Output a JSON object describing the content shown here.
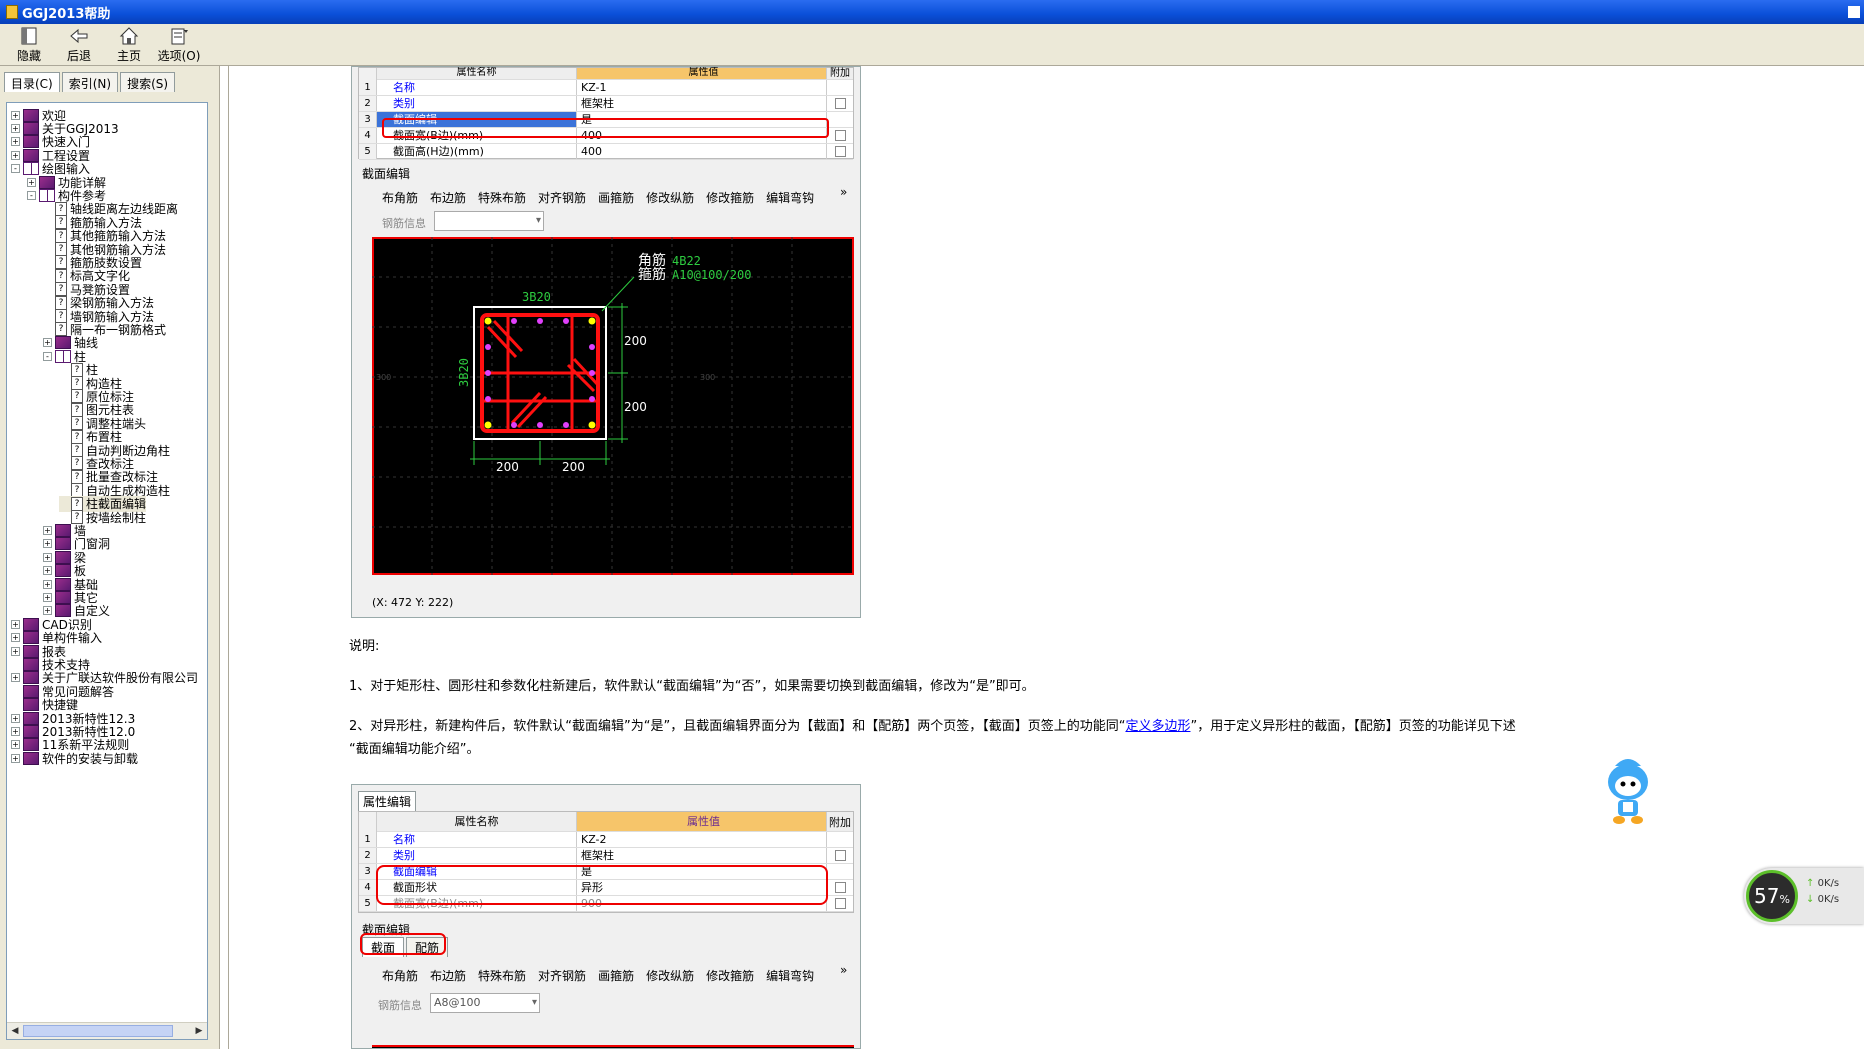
{
  "window": {
    "title": "GGJ2013帮助"
  },
  "toolbar": {
    "hide": "隐藏",
    "back": "后退",
    "home": "主页",
    "options": "选项(O)"
  },
  "tabs": {
    "contents": "目录(C)",
    "index": "索引(N)",
    "search": "搜索(S)"
  },
  "tree": [
    {
      "label": "欢迎",
      "level": 0,
      "kind": "book",
      "expander": "+"
    },
    {
      "label": "关于GGJ2013",
      "level": 0,
      "kind": "book",
      "expander": "+"
    },
    {
      "label": "快速入门",
      "level": 0,
      "kind": "book",
      "expander": "+"
    },
    {
      "label": "工程设置",
      "level": 0,
      "kind": "book",
      "expander": "+"
    },
    {
      "label": "绘图输入",
      "level": 0,
      "kind": "obook",
      "expander": "-"
    },
    {
      "label": "功能详解",
      "level": 1,
      "kind": "book",
      "expander": "+"
    },
    {
      "label": "构件参考",
      "level": 1,
      "kind": "obook",
      "expander": "-"
    },
    {
      "label": "轴线距离左边线距离",
      "level": 2,
      "kind": "page"
    },
    {
      "label": "箍筋输入方法",
      "level": 2,
      "kind": "page"
    },
    {
      "label": "其他箍筋输入方法",
      "level": 2,
      "kind": "page"
    },
    {
      "label": "其他钢筋输入方法",
      "level": 2,
      "kind": "page"
    },
    {
      "label": "箍筋肢数设置",
      "level": 2,
      "kind": "page"
    },
    {
      "label": "标高文字化",
      "level": 2,
      "kind": "page"
    },
    {
      "label": "马凳筋设置",
      "level": 2,
      "kind": "page"
    },
    {
      "label": "梁钢筋输入方法",
      "level": 2,
      "kind": "page"
    },
    {
      "label": "墙钢筋输入方法",
      "level": 2,
      "kind": "page"
    },
    {
      "label": "隔一布一钢筋格式",
      "level": 2,
      "kind": "page"
    },
    {
      "label": "轴线",
      "level": 2,
      "kind": "book",
      "expander": "+"
    },
    {
      "label": "柱",
      "level": 2,
      "kind": "obook",
      "expander": "-"
    },
    {
      "label": "柱",
      "level": 3,
      "kind": "page"
    },
    {
      "label": "构造柱",
      "level": 3,
      "kind": "page"
    },
    {
      "label": "原位标注",
      "level": 3,
      "kind": "page"
    },
    {
      "label": "图元柱表",
      "level": 3,
      "kind": "page"
    },
    {
      "label": "调整柱端头",
      "level": 3,
      "kind": "page"
    },
    {
      "label": "布置柱",
      "level": 3,
      "kind": "page"
    },
    {
      "label": "自动判断边角柱",
      "level": 3,
      "kind": "page"
    },
    {
      "label": "查改标注",
      "level": 3,
      "kind": "page"
    },
    {
      "label": "批量查改标注",
      "level": 3,
      "kind": "page"
    },
    {
      "label": "自动生成构造柱",
      "level": 3,
      "kind": "page"
    },
    {
      "label": "柱截面编辑",
      "level": 3,
      "kind": "page",
      "selected": true
    },
    {
      "label": "按墙绘制柱",
      "level": 3,
      "kind": "page"
    },
    {
      "label": "墙",
      "level": 2,
      "kind": "book",
      "expander": "+"
    },
    {
      "label": "门窗洞",
      "level": 2,
      "kind": "book",
      "expander": "+"
    },
    {
      "label": "梁",
      "level": 2,
      "kind": "book",
      "expander": "+"
    },
    {
      "label": "板",
      "level": 2,
      "kind": "book",
      "expander": "+"
    },
    {
      "label": "基础",
      "level": 2,
      "kind": "book",
      "expander": "+"
    },
    {
      "label": "其它",
      "level": 2,
      "kind": "book",
      "expander": "+"
    },
    {
      "label": "自定义",
      "level": 2,
      "kind": "book",
      "expander": "+"
    },
    {
      "label": "CAD识别",
      "level": 0,
      "kind": "book",
      "expander": "+"
    },
    {
      "label": "单构件输入",
      "level": 0,
      "kind": "book",
      "expander": "+"
    },
    {
      "label": "报表",
      "level": 0,
      "kind": "book",
      "expander": "+"
    },
    {
      "label": "技术支持",
      "level": 0,
      "kind": "book"
    },
    {
      "label": "关于广联达软件股份有限公司",
      "level": 0,
      "kind": "book",
      "expander": "+"
    },
    {
      "label": "常见问题解答",
      "level": 0,
      "kind": "book"
    },
    {
      "label": "快捷键",
      "level": 0,
      "kind": "book"
    },
    {
      "label": "2013新特性12.3",
      "level": 0,
      "kind": "book",
      "expander": "+"
    },
    {
      "label": "2013新特性12.0",
      "level": 0,
      "kind": "book",
      "expander": "+"
    },
    {
      "label": "11系新平法规则",
      "level": 0,
      "kind": "book",
      "expander": "+"
    },
    {
      "label": "软件的安装与卸载",
      "level": 0,
      "kind": "book",
      "expander": "+"
    }
  ],
  "shot1": {
    "header": {
      "name": "属性名称",
      "value": "属性值",
      "extra": "附加"
    },
    "rows": [
      {
        "n": "1",
        "name": "名称",
        "value": "KZ-1",
        "check": false
      },
      {
        "n": "2",
        "name": "类别",
        "value": "框架柱",
        "check": true
      },
      {
        "n": "3",
        "name": "截面编辑",
        "value": "是",
        "check": false
      },
      {
        "n": "4",
        "name": "截面宽(B边)(mm)",
        "value": "400",
        "check": true
      },
      {
        "n": "5",
        "name": "截面高(H边)(mm)",
        "value": "400",
        "check": true
      }
    ],
    "panel_title": "截面编辑",
    "tools": [
      "布角筋",
      "布边筋",
      "特殊布筋",
      "对齐钢筋",
      "画箍筋",
      "修改纵筋",
      "修改箍筋",
      "编辑弯钩"
    ],
    "more": "»",
    "rebar_info_label": "钢筋信息",
    "rebar_info_value": "",
    "drawing": {
      "corner_label": "角筋",
      "corner_value": "4B22",
      "stirrup_label": "箍筋",
      "stirrup_value": "A10@100/200",
      "top_label": "3B20",
      "left_label": "3B20",
      "dim_right_1": "200",
      "dim_right_2": "200",
      "dim_bottom_1": "200",
      "dim_bottom_2": "200",
      "axis_left": "300",
      "axis_right": "300"
    },
    "status": "(X: 472 Y: 222)"
  },
  "text": {
    "heading": "说明:",
    "p1": "1、对于矩形柱、圆形柱和参数化柱新建后，软件默认“截面编辑”为“否”，如果需要切换到截面编辑，修改为“是”即可。",
    "p2a": "2、对异形柱，新建构件后，软件默认“截面编辑”为“是”，且截面编辑界面分为【截面】和【配筋】两个页签，【截面】页签上的功能同“",
    "p2link": "定义多边形",
    "p2b": "”，用于定义异形柱的截面，【配筋】页签的功能详见下述",
    "p2c": "“截面编辑功能介绍”。"
  },
  "shot2": {
    "tab": "属性编辑",
    "header": {
      "name": "属性名称",
      "value": "属性值",
      "extra": "附加"
    },
    "rows": [
      {
        "n": "1",
        "name": "名称",
        "value": "KZ-2",
        "check": false
      },
      {
        "n": "2",
        "name": "类别",
        "value": "框架柱",
        "check": true
      },
      {
        "n": "3",
        "name": "截面编辑",
        "value": "是",
        "check": false
      },
      {
        "n": "4",
        "name": "截面形状",
        "value": "异形",
        "check": true
      },
      {
        "n": "5",
        "name": "截面宽(B边)(mm)",
        "value": "900",
        "check": true
      }
    ],
    "panel_title": "截面编辑",
    "subtabs": [
      "截面",
      "配筋"
    ],
    "tools": [
      "布角筋",
      "布边筋",
      "特殊布筋",
      "对齐钢筋",
      "画箍筋",
      "修改纵筋",
      "修改箍筋",
      "编辑弯钩"
    ],
    "more": "»",
    "rebar_info_label": "钢筋信息",
    "rebar_info_value": "A8@100"
  },
  "monitor": {
    "percent": "57",
    "unit": "%",
    "up": "0K/s",
    "down": "0K/s"
  },
  "colors": {
    "titlebar": "#0a4fd8",
    "accent_red": "#e00000",
    "rebar_red": "#ff1010",
    "dim_green": "#2ecc40",
    "link": "#0000ff"
  }
}
